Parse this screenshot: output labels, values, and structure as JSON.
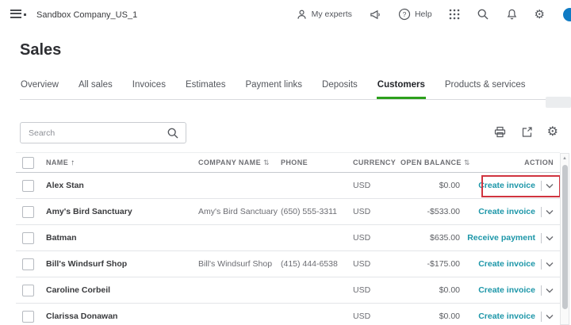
{
  "topbar": {
    "company_name": "Sandbox Company_US_1",
    "my_experts_label": "My experts",
    "help_label": "Help"
  },
  "page": {
    "title": "Sales"
  },
  "tabs": [
    "Overview",
    "All sales",
    "Invoices",
    "Estimates",
    "Payment links",
    "Deposits",
    "Customers",
    "Products & services"
  ],
  "active_tab": "Customers",
  "toolbar": {
    "search_placeholder": "Search"
  },
  "icons": {
    "sort_ascending": "↑",
    "sort_both": "⇅",
    "gear": "⚙",
    "help_mark": "?",
    "scroll_up": "▲"
  },
  "table": {
    "columns": {
      "name": "NAME",
      "company": "COMPANY NAME",
      "phone": "PHONE",
      "currency": "CURRENCY",
      "balance": "OPEN BALANCE",
      "action": "ACTION"
    },
    "rows": [
      {
        "name": "Alex Stan",
        "company": "",
        "phone": "",
        "currency": "USD",
        "open_balance": "$0.00",
        "action": "Create invoice",
        "highlighted": true
      },
      {
        "name": "Amy's Bird Sanctuary",
        "company": "Amy's Bird Sanctuary",
        "phone": "(650) 555-3311",
        "currency": "USD",
        "open_balance": "-$533.00",
        "action": "Create invoice",
        "highlighted": false
      },
      {
        "name": "Batman",
        "company": "",
        "phone": "",
        "currency": "USD",
        "open_balance": "$635.00",
        "action": "Receive payment",
        "highlighted": false
      },
      {
        "name": "Bill's Windsurf Shop",
        "company": "Bill's Windsurf Shop",
        "phone": "(415) 444-6538",
        "currency": "USD",
        "open_balance": "-$175.00",
        "action": "Create invoice",
        "highlighted": false
      },
      {
        "name": "Caroline Corbeil",
        "company": "",
        "phone": "",
        "currency": "USD",
        "open_balance": "$0.00",
        "action": "Create invoice",
        "highlighted": false
      },
      {
        "name": "Clarissa Donawan",
        "company": "",
        "phone": "",
        "currency": "USD",
        "open_balance": "$0.00",
        "action": "Create invoice",
        "highlighted": false
      }
    ]
  },
  "colors": {
    "accent_teal": "#1c96a8",
    "active_green": "#2ca01c",
    "highlight_red": "#d0343f",
    "avatar_blue": "#0f7bc4"
  }
}
